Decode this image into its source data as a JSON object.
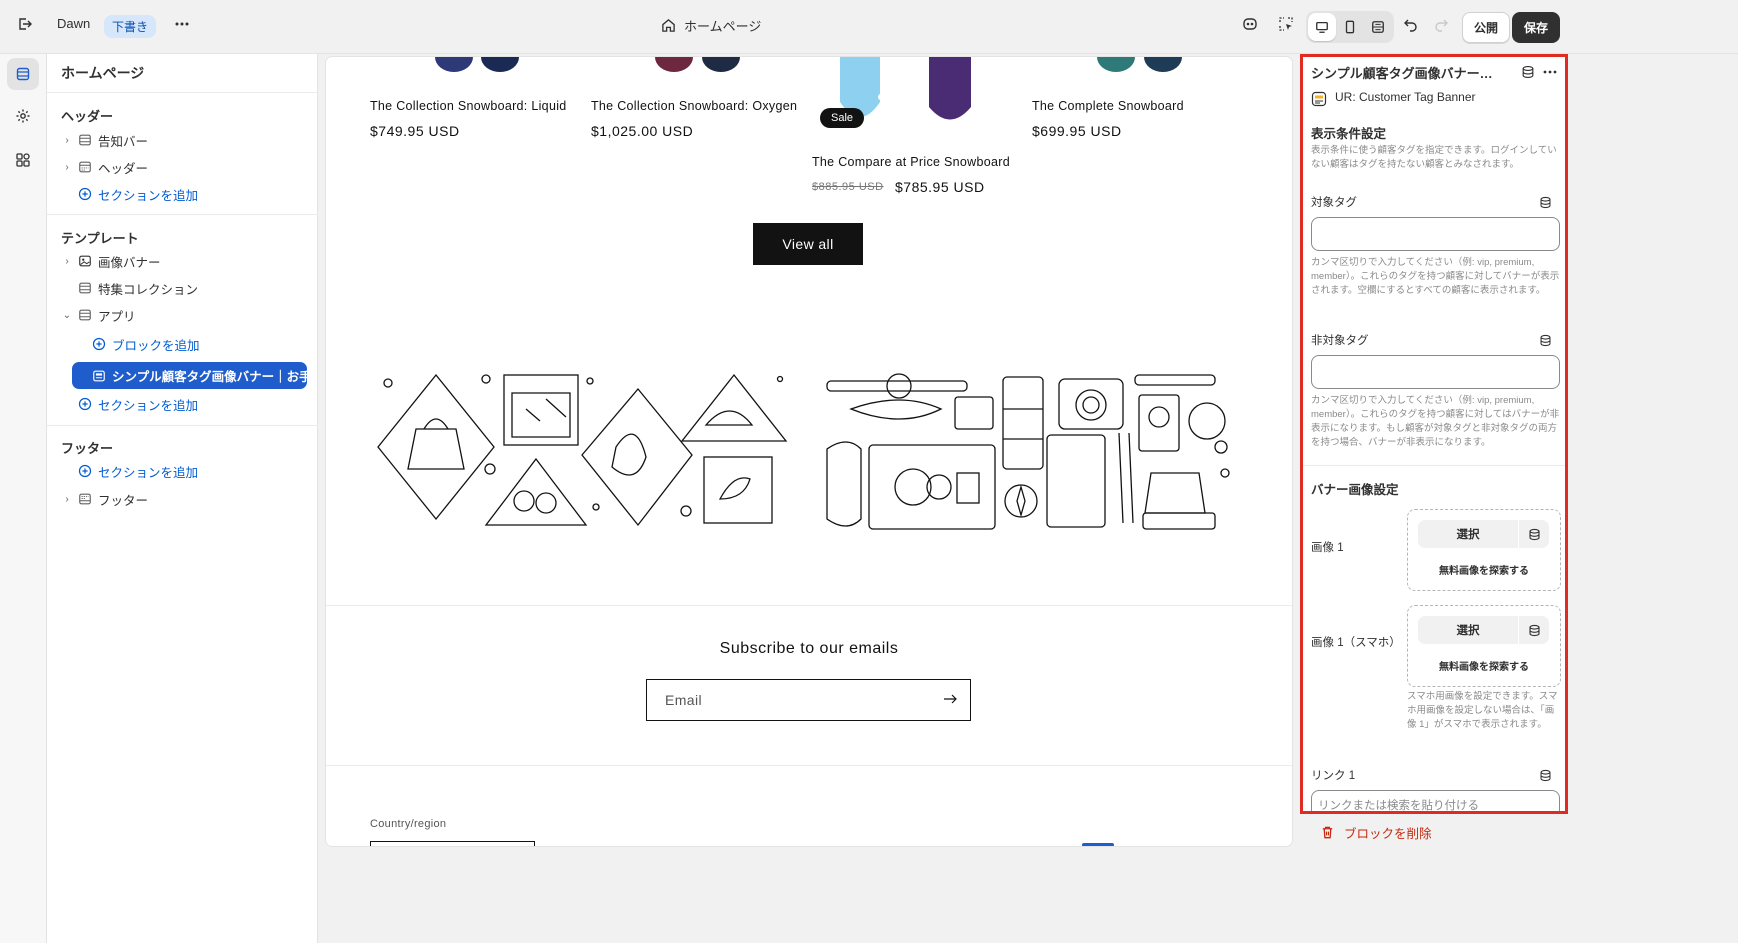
{
  "topbar": {
    "theme_name": "Dawn",
    "draft_badge": "下書き",
    "page_title": "ホームページ",
    "publish_label": "公開",
    "save_label": "保存"
  },
  "sidebar": {
    "title": "ホームページ",
    "header_group": "ヘッダー",
    "header_items": [
      "告知バー",
      "ヘッダー"
    ],
    "add_section": "セクションを追加",
    "template_group": "テンプレート",
    "template_items": [
      "画像バナー",
      "特集コレクション",
      "アプリ"
    ],
    "add_block": "ブロックを追加",
    "selected_block": "シンプル顧客タグ画像バナー｜お手...",
    "footer_group": "フッター",
    "footer_items": [
      "フッター"
    ]
  },
  "preview": {
    "products": [
      {
        "name": "The Collection Snowboard: Liquid",
        "price": "$749.95 USD"
      },
      {
        "name": "The Collection Snowboard: Oxygen",
        "price": "$1,025.00 USD"
      },
      {
        "name": "The Compare at Price Snowboard",
        "compare_price": "$885.95 USD",
        "price": "$785.95 USD",
        "badge": "Sale"
      },
      {
        "name": "The Complete Snowboard",
        "price": "$699.95 USD"
      }
    ],
    "view_all": "View all",
    "subscribe_title": "Subscribe to our emails",
    "email_placeholder": "Email",
    "country_label": "Country/region"
  },
  "panel": {
    "title": "シンプル顧客タグ画像バナー｜...",
    "app_name": "UR: Customer Tag Banner",
    "display_heading": "表示条件設定",
    "display_help": "表示条件に使う顧客タグを指定できます。ログインしていない顧客はタグを持たない顧客とみなされます。",
    "target_label": "対象タグ",
    "target_help": "カンマ区切りで入力してください（例: vip, premium, member）。これらのタグを持つ顧客に対してバナーが表示されます。空欄にするとすべての顧客に表示されます。",
    "exclude_label": "非対象タグ",
    "exclude_help": "カンマ区切りで入力してください（例: vip, premium, member）。これらのタグを持つ顧客に対してはバナーが非表示になります。もし顧客が対象タグと非対象タグの両方を持つ場合、バナーが非表示になります。",
    "banner_heading": "バナー画像設定",
    "image1_label": "画像 1",
    "image1_mobile_label": "画像 1（スマホ）",
    "select_label": "選択",
    "explore_label": "無料画像を探索する",
    "mobile_help": "スマホ用画像を設定できます。スマホ用画像を設定しない場合は、「画像 1」がスマホで表示されます。",
    "link1_label": "リンク 1",
    "link_placeholder": "リンクまたは検索を貼り付ける"
  },
  "delete_label": "ブロックを削除",
  "colors": {
    "accent_blue": "#1f5ccc",
    "highlight_red": "#e02b20",
    "danger": "#c5280c"
  }
}
